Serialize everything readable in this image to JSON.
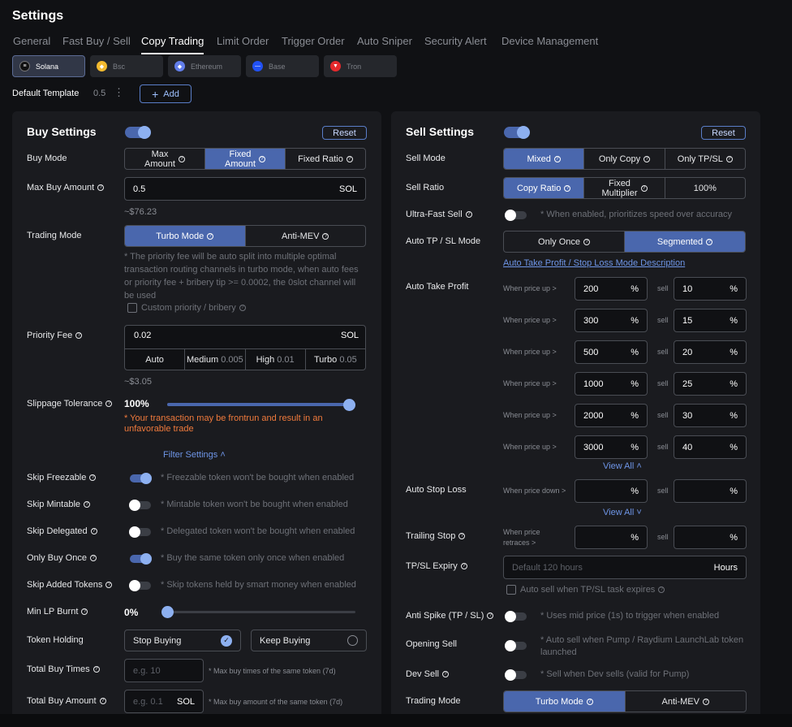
{
  "title": "Settings",
  "tabs": [
    "General",
    "Fast Buy / Sell",
    "Copy Trading",
    "Limit Order",
    "Trigger Order",
    "Auto Sniper",
    "Security Alert",
    "Device Management"
  ],
  "chains": [
    "Solana",
    "Bsc",
    "Ethereum",
    "Base",
    "Tron"
  ],
  "template": {
    "label": "Default Template",
    "value": "0.5",
    "add": "Add"
  },
  "buy": {
    "title": "Buy Settings",
    "reset": "Reset",
    "buy_mode": {
      "label": "Buy Mode",
      "options": [
        "Max\nAmount",
        "Fixed\nAmount",
        "Fixed Ratio"
      ]
    },
    "max_buy": {
      "label": "Max Buy Amount",
      "value": "0.5",
      "unit": "SOL",
      "usd": "~$76.23"
    },
    "trading_mode": {
      "label": "Trading Mode",
      "options": [
        "Turbo Mode",
        "Anti-MEV"
      ],
      "note": "* The priority fee will be auto split into multiple optimal transaction routing channels in turbo mode, when auto fees or priority fee + bribery tip >= 0.0002, the 0slot channel will be used",
      "custom": "Custom priority / bribery"
    },
    "priority_fee": {
      "label": "Priority Fee",
      "value": "0.02",
      "unit": "SOL",
      "usd": "~$3.05",
      "levels": [
        {
          "name": "Auto",
          "val": ""
        },
        {
          "name": "Medium",
          "val": "0.005"
        },
        {
          "name": "High",
          "val": "0.01"
        },
        {
          "name": "Turbo",
          "val": "0.05"
        }
      ]
    },
    "slippage": {
      "label": "Slippage Tolerance",
      "value": "100%",
      "level": 1.0,
      "warning": "* Your transaction may be frontrun and result in an unfavorable trade"
    },
    "filter": "Filter Settings",
    "toggles": [
      {
        "label": "Skip Freezable",
        "on": true,
        "note": "* Freezable token won't be bought when enabled"
      },
      {
        "label": "Skip Mintable",
        "on": false,
        "note": "* Mintable token won't be bought when enabled"
      },
      {
        "label": "Skip Delegated",
        "on": false,
        "note": "* Delegated token won't be bought when enabled"
      },
      {
        "label": "Only Buy Once",
        "on": true,
        "note": "* Buy the same token only once when enabled"
      },
      {
        "label": "Skip Added Tokens",
        "on": false,
        "note": "* Skip tokens held by smart money when enabled"
      }
    ],
    "min_lp": {
      "label": "Min LP Burnt",
      "value": "0%",
      "level": 0.0
    },
    "token_holding": {
      "label": "Token Holding",
      "options": [
        "Stop Buying",
        "Keep Buying"
      ]
    },
    "total_buy_times": {
      "label": "Total Buy Times",
      "placeholder": "e.g. 10",
      "note": "* Max buy times of the same token (7d)"
    },
    "total_buy_amount": {
      "label": "Total Buy Amount",
      "placeholder": "e.g. 0.1",
      "unit": "SOL",
      "note": "* Max buy amount of the same token (7d)"
    }
  },
  "sell": {
    "title": "Sell Settings",
    "reset": "Reset",
    "sell_mode": {
      "label": "Sell Mode",
      "options": [
        "Mixed",
        "Only Copy",
        "Only TP/SL"
      ]
    },
    "sell_ratio": {
      "label": "Sell Ratio",
      "options": [
        "Copy Ratio",
        "Fixed\nMultiplier",
        "100%"
      ]
    },
    "ultra_fast": {
      "label": "Ultra-Fast Sell",
      "note": "* When enabled, prioritizes speed over accuracy"
    },
    "auto_tpsl": {
      "label": "Auto TP / SL Mode",
      "options": [
        "Only Once",
        "Segmented"
      ],
      "link": "Auto Take Profit / Stop Loss Mode Description"
    },
    "auto_tp": {
      "label": "Auto Take Profit",
      "when": "When price up >",
      "sell": "sell",
      "rows": [
        [
          "200",
          "10"
        ],
        [
          "300",
          "15"
        ],
        [
          "500",
          "20"
        ],
        [
          "1000",
          "25"
        ],
        [
          "2000",
          "30"
        ],
        [
          "3000",
          "40"
        ]
      ],
      "view_all": "View All"
    },
    "auto_sl": {
      "label": "Auto Stop Loss",
      "when": "When price down >",
      "sell": "sell",
      "view_all": "View All"
    },
    "trailing": {
      "label": "Trailing Stop",
      "when": "When price\nretraces >",
      "sell": "sell"
    },
    "expiry": {
      "label": "TP/SL Expiry",
      "placeholder": "Default 120 hours",
      "unit": "Hours",
      "auto": "Auto sell when TP/SL task expires"
    },
    "anti_spike": {
      "label": "Anti Spike (TP / SL)",
      "note": "* Uses mid price (1s) to trigger when enabled"
    },
    "opening": {
      "label": "Opening Sell",
      "note": "* Auto sell when Pump / Raydium LaunchLab token launched"
    },
    "dev_sell": {
      "label": "Dev Sell",
      "note": "* Sell when Dev sells (valid for Pump)"
    },
    "trading_mode": {
      "label": "Trading Mode",
      "options": [
        "Turbo Mode",
        "Anti-MEV"
      ]
    }
  },
  "pct": "%"
}
